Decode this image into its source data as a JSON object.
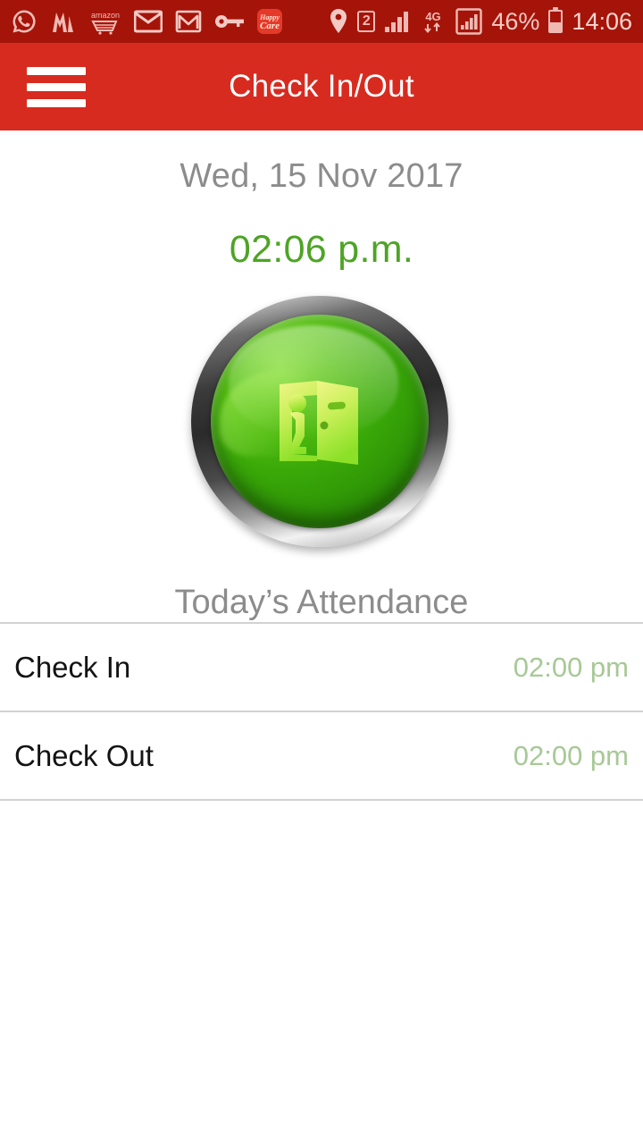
{
  "status_bar": {
    "background": "#A51409",
    "notification_icons": [
      {
        "name": "whatsapp-icon",
        "label": "WhatsApp"
      },
      {
        "name": "myntra-icon",
        "label": "Myntra"
      },
      {
        "name": "amazon-icon",
        "label": "amazon"
      },
      {
        "name": "mail-icon",
        "label": "Email"
      },
      {
        "name": "gmail-icon",
        "label": "Gmail"
      },
      {
        "name": "key-icon",
        "label": "Key"
      },
      {
        "name": "happy-care-icon",
        "label": "Happy Care",
        "line1": "Happy",
        "line2": "Care"
      }
    ],
    "location_icon": "location-pin-icon",
    "sim_indicator": "2",
    "network_type": "4G",
    "battery_percent": "46%",
    "clock": "14:06"
  },
  "app_bar": {
    "background": "#D82B20",
    "menu_icon": "hamburger-menu-icon",
    "title": "Check In/Out"
  },
  "main": {
    "date": "Wed, 15 Nov 2017",
    "time": "02:06 p.m.",
    "date_color": "#8C8C8C",
    "time_color": "#4EA425",
    "action_button": {
      "name": "check-in-out-button",
      "icon": "person-exit-door-icon",
      "color": "#39A808"
    },
    "attendance_title": "Today’s Attendance",
    "rows": [
      {
        "label": "Check In",
        "time": "02:00 pm"
      },
      {
        "label": "Check Out",
        "time": "02:00 pm"
      }
    ],
    "row_time_color": "#A7C996"
  }
}
